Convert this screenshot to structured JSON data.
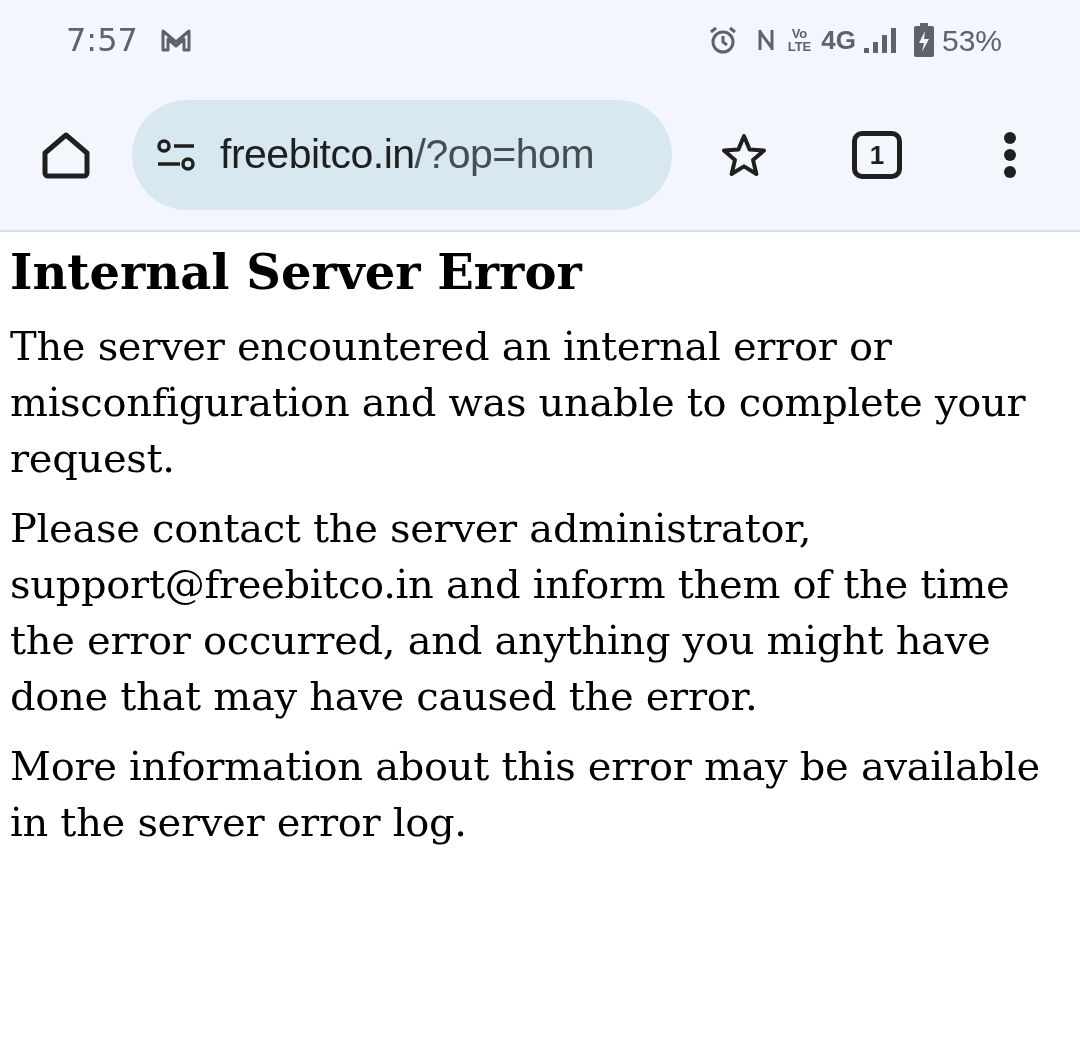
{
  "status_bar": {
    "time": "7:57",
    "network": "4G",
    "volte_top": "Vo",
    "volte_bottom": "LTE",
    "battery": "53%"
  },
  "toolbar": {
    "url_host": "freebitco.in",
    "url_path": "/?op=hom",
    "tab_count": "1"
  },
  "page": {
    "heading": "Internal Server Error",
    "paragraphs": [
      "The server encountered an internal error or misconfiguration and was unable to complete your request.",
      "Please contact the server administrator, support@freebitco.in and inform them of the time the error occurred, and anything you might have done that may have caused the error.",
      "More information about this error may be available in the server error log."
    ]
  }
}
